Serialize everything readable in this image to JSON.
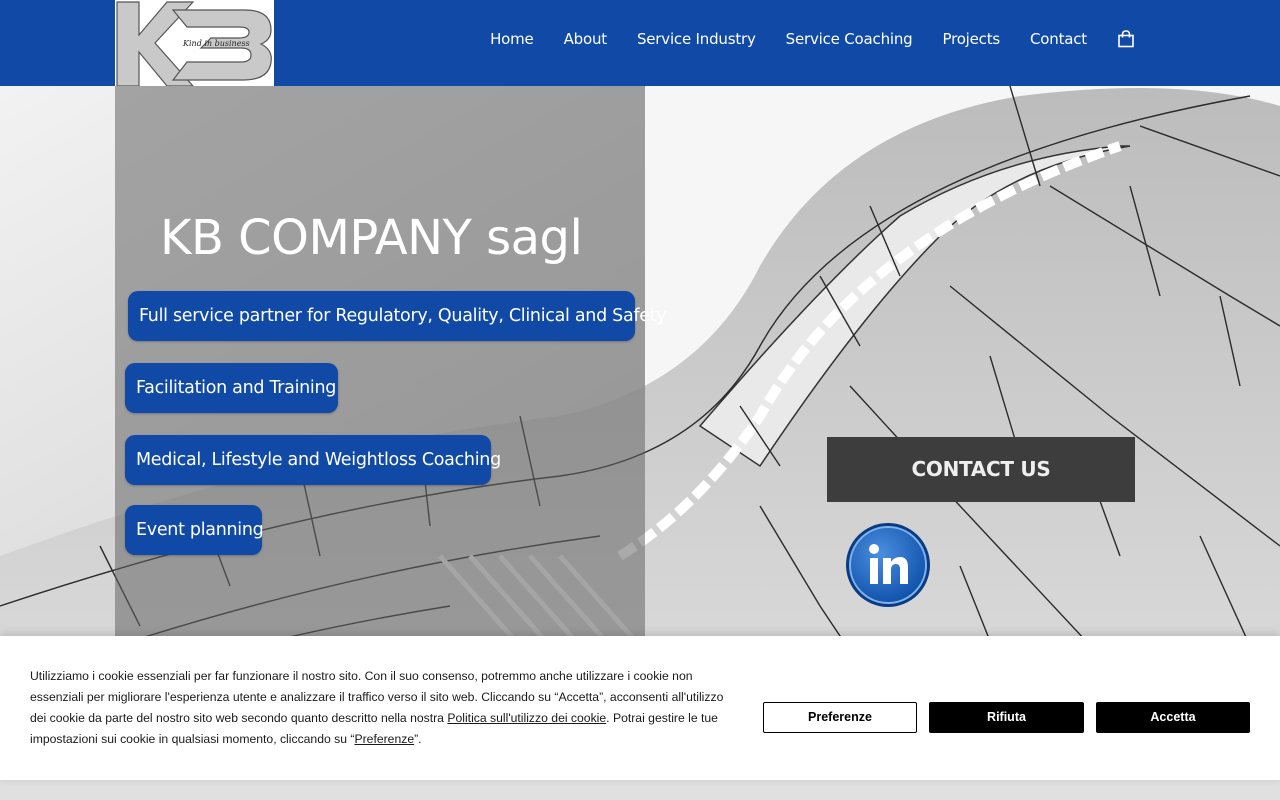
{
  "header": {
    "logo_text": "Kind in business",
    "nav": [
      "Home",
      "About",
      "Service Industry",
      "Service Coaching",
      "Projects",
      "Contact"
    ],
    "cart_icon": "shopping-bag-icon"
  },
  "hero": {
    "title": "KB COMPANY sagl",
    "services": [
      "Full service partner for Regulatory, Quality, Clinical and Safety",
      "Facilitation and Training",
      "Medical, Lifestyle and Weightloss Coaching",
      "Event planning"
    ],
    "contact_label": "CONTACT US",
    "linkedin_icon": "linkedin-icon"
  },
  "cookie": {
    "text_1": "Utilizziamo i cookie essenziali per far funzionare il nostro sito. Con il suo consenso, potremmo anche utilizzare i cookie non essenziali per migliorare l'esperienza utente e analizzare il traffico verso il sito web. Cliccando su “Accetta”, acconsenti all'utilizzo dei cookie da parte del nostro sito web secondo quanto descritto nella nostra ",
    "policy_link": "Politica sull'utilizzo dei cookie",
    "text_2": ". Potrai gestire le tue impostazioni sui cookie in qualsiasi momento, cliccando su “",
    "pref_link": "Preferenze",
    "text_3": "”.",
    "btn_preferences": "Preferenze",
    "btn_reject": "Rifiuta",
    "btn_accept": "Accetta"
  },
  "colors": {
    "brand_blue": "#104aa6",
    "contact_button": "#3d3d3d",
    "cookie_button": "#000000"
  }
}
